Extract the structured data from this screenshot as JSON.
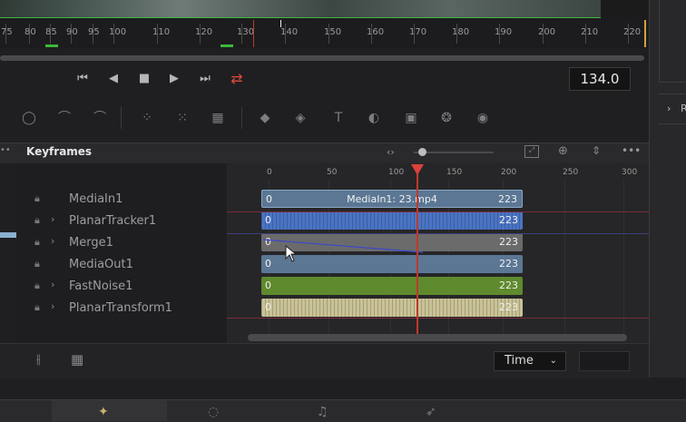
{
  "ruler": {
    "ticks": [
      "75",
      "80",
      "85",
      "90",
      "95",
      "100",
      "110",
      "120",
      "130",
      "140",
      "150",
      "160",
      "170",
      "180",
      "190",
      "200",
      "210",
      "220"
    ]
  },
  "transport": {
    "first_frame_icon": "skip-to-start-icon",
    "reverse_icon": "play-reverse-icon",
    "stop_icon": "stop-icon",
    "play_icon": "play-icon",
    "last_frame_icon": "skip-to-end-icon",
    "loop_icon": "loop-icon",
    "current_time": "134.0",
    "loop_color": "#e04a3a"
  },
  "right_panel": {
    "collapsed_label": "R"
  },
  "keyframes": {
    "title": "Keyframes",
    "scale_ticks": [
      "0",
      "50",
      "100",
      "150",
      "200",
      "250",
      "300"
    ],
    "nodes": [
      {
        "name": "MediaIn1",
        "expandable": false,
        "start": "0",
        "label": "MediaIn1: 23.mp4",
        "end": "223",
        "color": "#5b7794"
      },
      {
        "name": "PlanarTracker1",
        "expandable": true,
        "start": "0",
        "label": "",
        "end": "223",
        "color": "#4a74c4"
      },
      {
        "name": "Merge1",
        "expandable": true,
        "start": "0",
        "label": "",
        "end": "223",
        "color": "#6b6b6b"
      },
      {
        "name": "MediaOut1",
        "expandable": false,
        "start": "0",
        "label": "",
        "end": "223",
        "color": "#5b7794"
      },
      {
        "name": "FastNoise1",
        "expandable": true,
        "start": "0",
        "label": "",
        "end": "223",
        "color": "#5f8a2e"
      },
      {
        "name": "PlanarTransform1",
        "expandable": true,
        "start": "0",
        "label": "",
        "end": "223",
        "color": "#c9c296"
      }
    ]
  },
  "bottom": {
    "time_mode": "Time"
  }
}
